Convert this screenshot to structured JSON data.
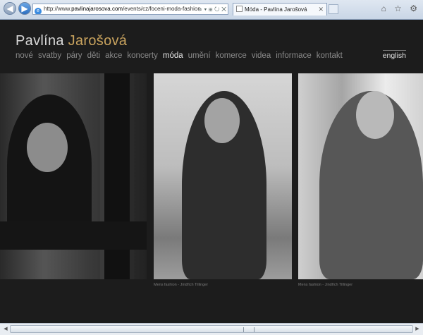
{
  "browser": {
    "address_prefix": "http://www.",
    "address_domain": "pavlinajarosova.com",
    "address_path": "/events/cz/foceni-moda-fashion",
    "address_tools": "⌕ ▾ ⊞ ↻ ✕",
    "tab_title": "Móda - Pavlína Jarošová",
    "tab_close": "✕",
    "window_tools": "⌂ ☆ ⚙"
  },
  "site": {
    "brand_first": "Pavlína",
    "brand_last": "Jarošová",
    "language": "english",
    "menu": [
      {
        "label": "nové"
      },
      {
        "label": "svatby"
      },
      {
        "label": "páry"
      },
      {
        "label": "děti"
      },
      {
        "label": "akce"
      },
      {
        "label": "koncerty"
      },
      {
        "label": "móda",
        "active": true
      },
      {
        "label": "umění"
      },
      {
        "label": "komerce"
      },
      {
        "label": "videa"
      },
      {
        "label": "informace"
      },
      {
        "label": "kontakt"
      }
    ]
  },
  "captions": [
    "Mens fashion - Jindřich Tillinger",
    "Mens fashion - Jindřich Tillinger"
  ],
  "scrollbar": {
    "left_arrow": "◀",
    "right_arrow": "▶"
  }
}
